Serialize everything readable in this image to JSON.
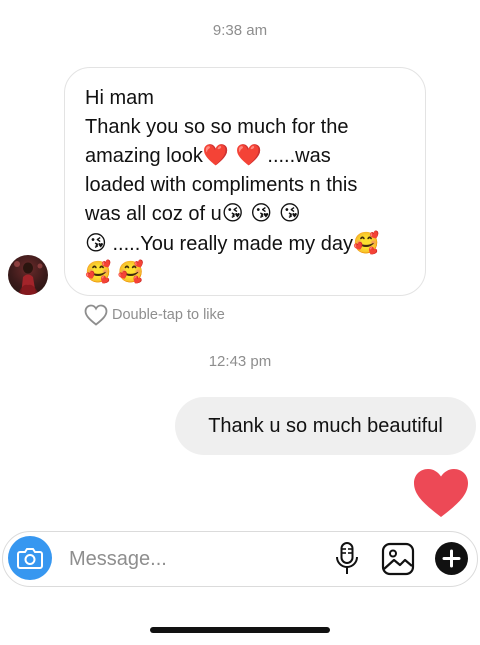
{
  "timestamps": {
    "first": "9:38 am",
    "second": "12:43 pm"
  },
  "incoming": {
    "text": "Hi mam\nThank you so so much for the\namazing look",
    "emojis": {
      "hearts": "❤️ ❤️",
      "kiss3": "😘 😘 😘",
      "kiss1": "😘",
      "smile1": "🥰",
      "smile2": "🥰 🥰"
    },
    "fragments": {
      "after_hearts": " .....was",
      "line3": "loaded with compliments n this",
      "line4": "was all coz of u",
      "line5": " .....You really made my day"
    }
  },
  "like_hint": "Double-tap to like",
  "outgoing": {
    "text": "Thank u so much beautiful"
  },
  "composer": {
    "placeholder": "Message..."
  },
  "icons": {
    "camera": "camera-icon",
    "mic": "microphone-icon",
    "gallery": "gallery-icon",
    "plus": "plus-icon",
    "like": "heart-outline-icon",
    "sent_like": "heart-filled-icon"
  },
  "colors": {
    "accent_blue": "#3797f0",
    "heart_red": "#ed4956",
    "bubble_gray": "#efefef",
    "meta_gray": "#8e8e8e"
  }
}
